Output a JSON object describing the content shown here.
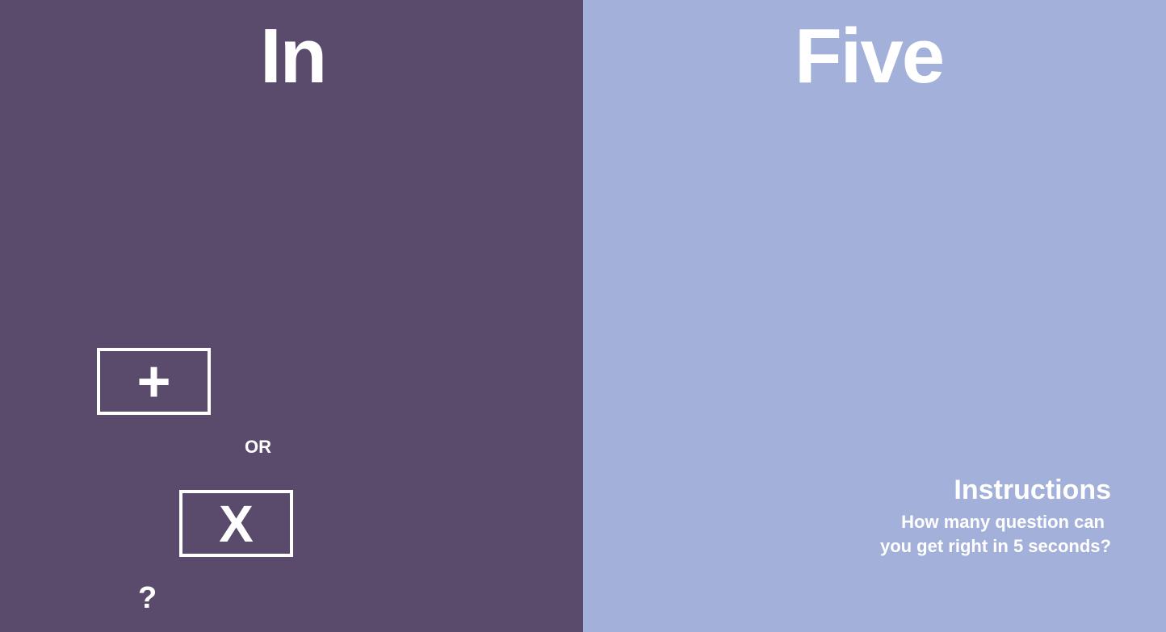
{
  "left_panel": {
    "title": "In",
    "background": "#5a4b6c",
    "plus_option": {
      "label": "+",
      "icon": "plus-icon"
    },
    "or_text": "OR",
    "times_option": {
      "label": "X",
      "icon": "multiply-icon"
    },
    "question_mark": "?"
  },
  "right_panel": {
    "title": "Five",
    "background": "#a3b0d9",
    "instructions": {
      "title": "Instructions",
      "line1": "How many question can",
      "line2": "you get right in 5 seconds?"
    }
  },
  "colors": {
    "text": "#ffffff"
  }
}
